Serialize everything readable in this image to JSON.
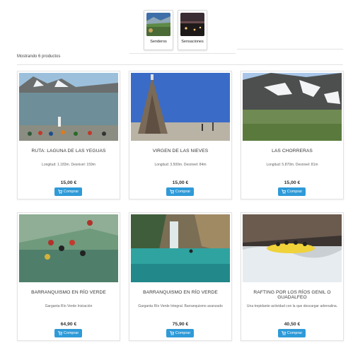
{
  "categories": [
    {
      "label": "Senderos"
    },
    {
      "label": "Sensaciones"
    }
  ],
  "result_count": "Mostrando 6 productos",
  "products": [
    {
      "title": "RUTA: LAGUNA DE LAS YEGUAS",
      "desc": "Longitud: 1.183m. Desnivel: 159m",
      "price": "15,00 €",
      "button": "Comprar"
    },
    {
      "title": "VIRGEN DE LAS NIEVES",
      "desc": "Longitud: 3.500m. Desnivel: 84m",
      "price": "15,00 €",
      "button": "Comprar"
    },
    {
      "title": "LAS CHORRERAS",
      "desc": "Longitud: 5.870m. Desnivel: 81m",
      "price": "15,00 €",
      "button": "Comprar"
    },
    {
      "title": "BARRANQUISMO EN RÍO VERDE",
      "desc": "Garganta Río Verde Iniciación",
      "price": "64,90 €",
      "button": "Comprar"
    },
    {
      "title": "BARRANQUISMO EN RÍO VERDE",
      "desc": "Garganta Río Verde Integral. Barranquismo avanzado",
      "price": "75,90 €",
      "button": "Comprar"
    },
    {
      "title": "RAFTING POR LOS RÍOS GENIL O GUADALFEO",
      "desc": "Una trepidante actividad con la que descargar adrenalina.",
      "price": "40,50 €",
      "button": "Comprar"
    }
  ],
  "colors": {
    "button": "#2f9ad8",
    "text": "#333333",
    "border": "#e2e2e2"
  }
}
